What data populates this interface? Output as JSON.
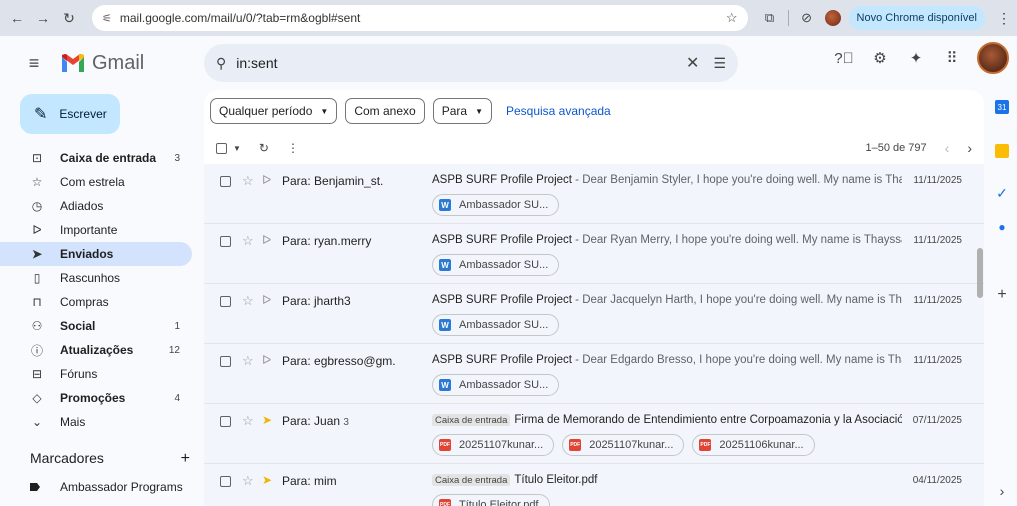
{
  "browser": {
    "url": "mail.google.com/mail/u/0/?tab=rm&ogbl#sent",
    "update_label": "Novo Chrome disponível"
  },
  "gmail": {
    "logo_text": "Gmail",
    "search_value": "in:sent",
    "compose_label": "Escrever"
  },
  "sidebar": {
    "items": [
      {
        "label": "Caixa de entrada",
        "count": "3",
        "icon": "inbox-icon",
        "glyph": "⊡"
      },
      {
        "label": "Com estrela",
        "count": "",
        "icon": "star-icon",
        "glyph": "☆"
      },
      {
        "label": "Adiados",
        "count": "",
        "icon": "clock-icon",
        "glyph": "◷"
      },
      {
        "label": "Importante",
        "count": "",
        "icon": "important-icon",
        "glyph": "ᐅ"
      },
      {
        "label": "Enviados",
        "count": "",
        "icon": "send-icon",
        "glyph": "➤"
      },
      {
        "label": "Rascunhos",
        "count": "",
        "icon": "draft-icon",
        "glyph": "▯"
      },
      {
        "label": "Compras",
        "count": "",
        "icon": "shopping-icon",
        "glyph": "⊓"
      },
      {
        "label": "Social",
        "count": "1",
        "icon": "people-icon",
        "glyph": "⚇"
      },
      {
        "label": "Atualizações",
        "count": "12",
        "icon": "info-icon",
        "glyph": "ⓘ"
      },
      {
        "label": "Fóruns",
        "count": "",
        "icon": "forum-icon",
        "glyph": "⊟"
      },
      {
        "label": "Promoções",
        "count": "4",
        "icon": "tag-icon",
        "glyph": "◇"
      },
      {
        "label": "Mais",
        "count": "",
        "icon": "chevron-down-icon",
        "glyph": "⌄"
      }
    ],
    "labels_title": "Marcadores",
    "label_items": [
      "Ambassador Programs"
    ]
  },
  "filters": {
    "period": "Qualquer período",
    "attachment": "Com anexo",
    "to": "Para",
    "advanced": "Pesquisa avançada"
  },
  "toolbar": {
    "pager": "1–50 de 797"
  },
  "emails": [
    {
      "sender": "Para: Benjamin_st.",
      "count": "",
      "tag": "",
      "subject": "ASPB SURF Profile Project",
      "snippet": " - Dear Benjamin Styler, I hope you're doing well. My name is Thayssa ...",
      "date": "11/11/2025",
      "attachments": [
        {
          "type": "W",
          "name": "Ambassador SU..."
        }
      ]
    },
    {
      "sender": "Para: ryan.merry",
      "count": "",
      "tag": "",
      "subject": "ASPB SURF Profile Project",
      "snippet": " - Dear Ryan Merry, I hope you're doing well. My name is Thayssa Rabe...",
      "date": "11/11/2025",
      "attachments": [
        {
          "type": "W",
          "name": "Ambassador SU..."
        }
      ]
    },
    {
      "sender": "Para: jharth3",
      "count": "",
      "tag": "",
      "subject": "ASPB SURF Profile Project",
      "snippet": " - Dear Jacquelyn Harth, I hope you're doing well. My name is Thayssa ...",
      "date": "11/11/2025",
      "attachments": [
        {
          "type": "W",
          "name": "Ambassador SU..."
        }
      ]
    },
    {
      "sender": "Para: egbresso@gm.",
      "count": "",
      "tag": "",
      "subject": "ASPB SURF Profile Project",
      "snippet": " - Dear Edgardo Bresso, I hope you're doing well. My name is Thayssa ...",
      "date": "11/11/2025",
      "attachments": [
        {
          "type": "W",
          "name": "Ambassador SU..."
        }
      ]
    },
    {
      "sender": "Para: Juan",
      "count": "3",
      "tag": "Caixa de entrada",
      "subject": "Firma de Memorando de Entendimiento entre Corpoamazonia y la Asociación K...",
      "snippet": "",
      "date": "07/11/2025",
      "attachments": [
        {
          "type": "PDF",
          "name": "20251107kunar..."
        },
        {
          "type": "PDF",
          "name": "20251107kunar..."
        },
        {
          "type": "PDF",
          "name": "20251106kunar..."
        }
      ]
    },
    {
      "sender": "Para: mim",
      "count": "",
      "tag": "Caixa de entrada",
      "subject": "Título Eleitor.pdf",
      "snippet": "",
      "date": "04/11/2025",
      "attachments": [
        {
          "type": "PDF",
          "name": "Título Eleitor.pdf"
        }
      ]
    }
  ]
}
